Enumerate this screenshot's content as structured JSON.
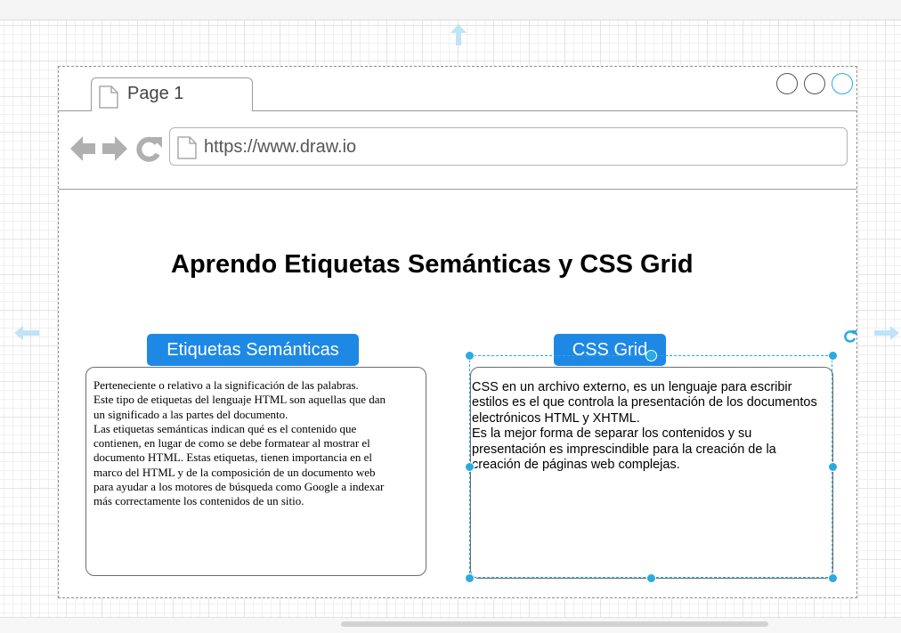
{
  "browser": {
    "tab_label": "Page 1",
    "url": "https://www.draw.io"
  },
  "page": {
    "title": "Aprendo Etiquetas Semánticas y CSS Grid"
  },
  "cards": [
    {
      "heading": "Etiquetas Semánticas",
      "text": "Perteneciente o relativo a la significación de las palabras.\n Este tipo de etiquetas del lenguaje HTML son aquellas que dan\nun significado a las partes del documento.\nLas etiquetas semánticas indican qué es el contenido que\ncontienen, en lugar de como se debe formatear al mostrar el\ndocumento HTML. Estas   etiquetas, tienen importancia en el\n marco del HTML y de la composición de un documento web\n para ayudar a los motores de búsqueda como Google a indexar\n más correctamente los contenidos de un sitio."
    },
    {
      "heading": "CSS Grid",
      "text": "CSS en un archivo externo, es un lenguaje para escribir\nestilos es el que controla la presentación de los documentos\nelectrónicos HTML y XHTML.\nEs la mejor forma de separar los contenidos y su\npresentación es imprescindible para la creación de la\ncreación de páginas web complejas."
    }
  ],
  "colors": {
    "accent_blue": "#1e88e5",
    "selection_blue": "#29abe2"
  }
}
